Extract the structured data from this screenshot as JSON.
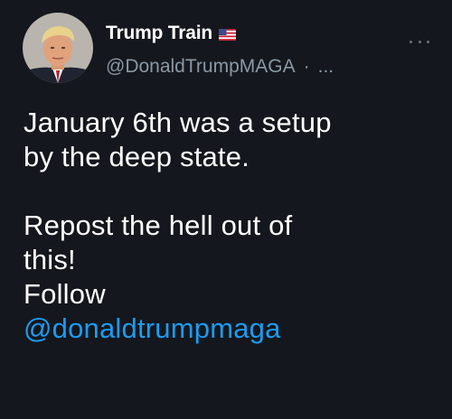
{
  "author": {
    "display_name": "Trump Train",
    "flag_icon": "us-flag-icon",
    "handle": "@DonaldTrumpMAGA",
    "separator": "·",
    "truncation": "..."
  },
  "tweet": {
    "line1": "January 6th was a setup",
    "line2": "by the deep state.",
    "line3": "Repost the hell out of",
    "line4": "this!",
    "line5": "Follow",
    "mention": "@donaldtrumpmaga"
  },
  "colors": {
    "background": "#14171d",
    "text": "#ffffff",
    "secondary_text": "#8b98a5",
    "link": "#1d9bf0"
  }
}
